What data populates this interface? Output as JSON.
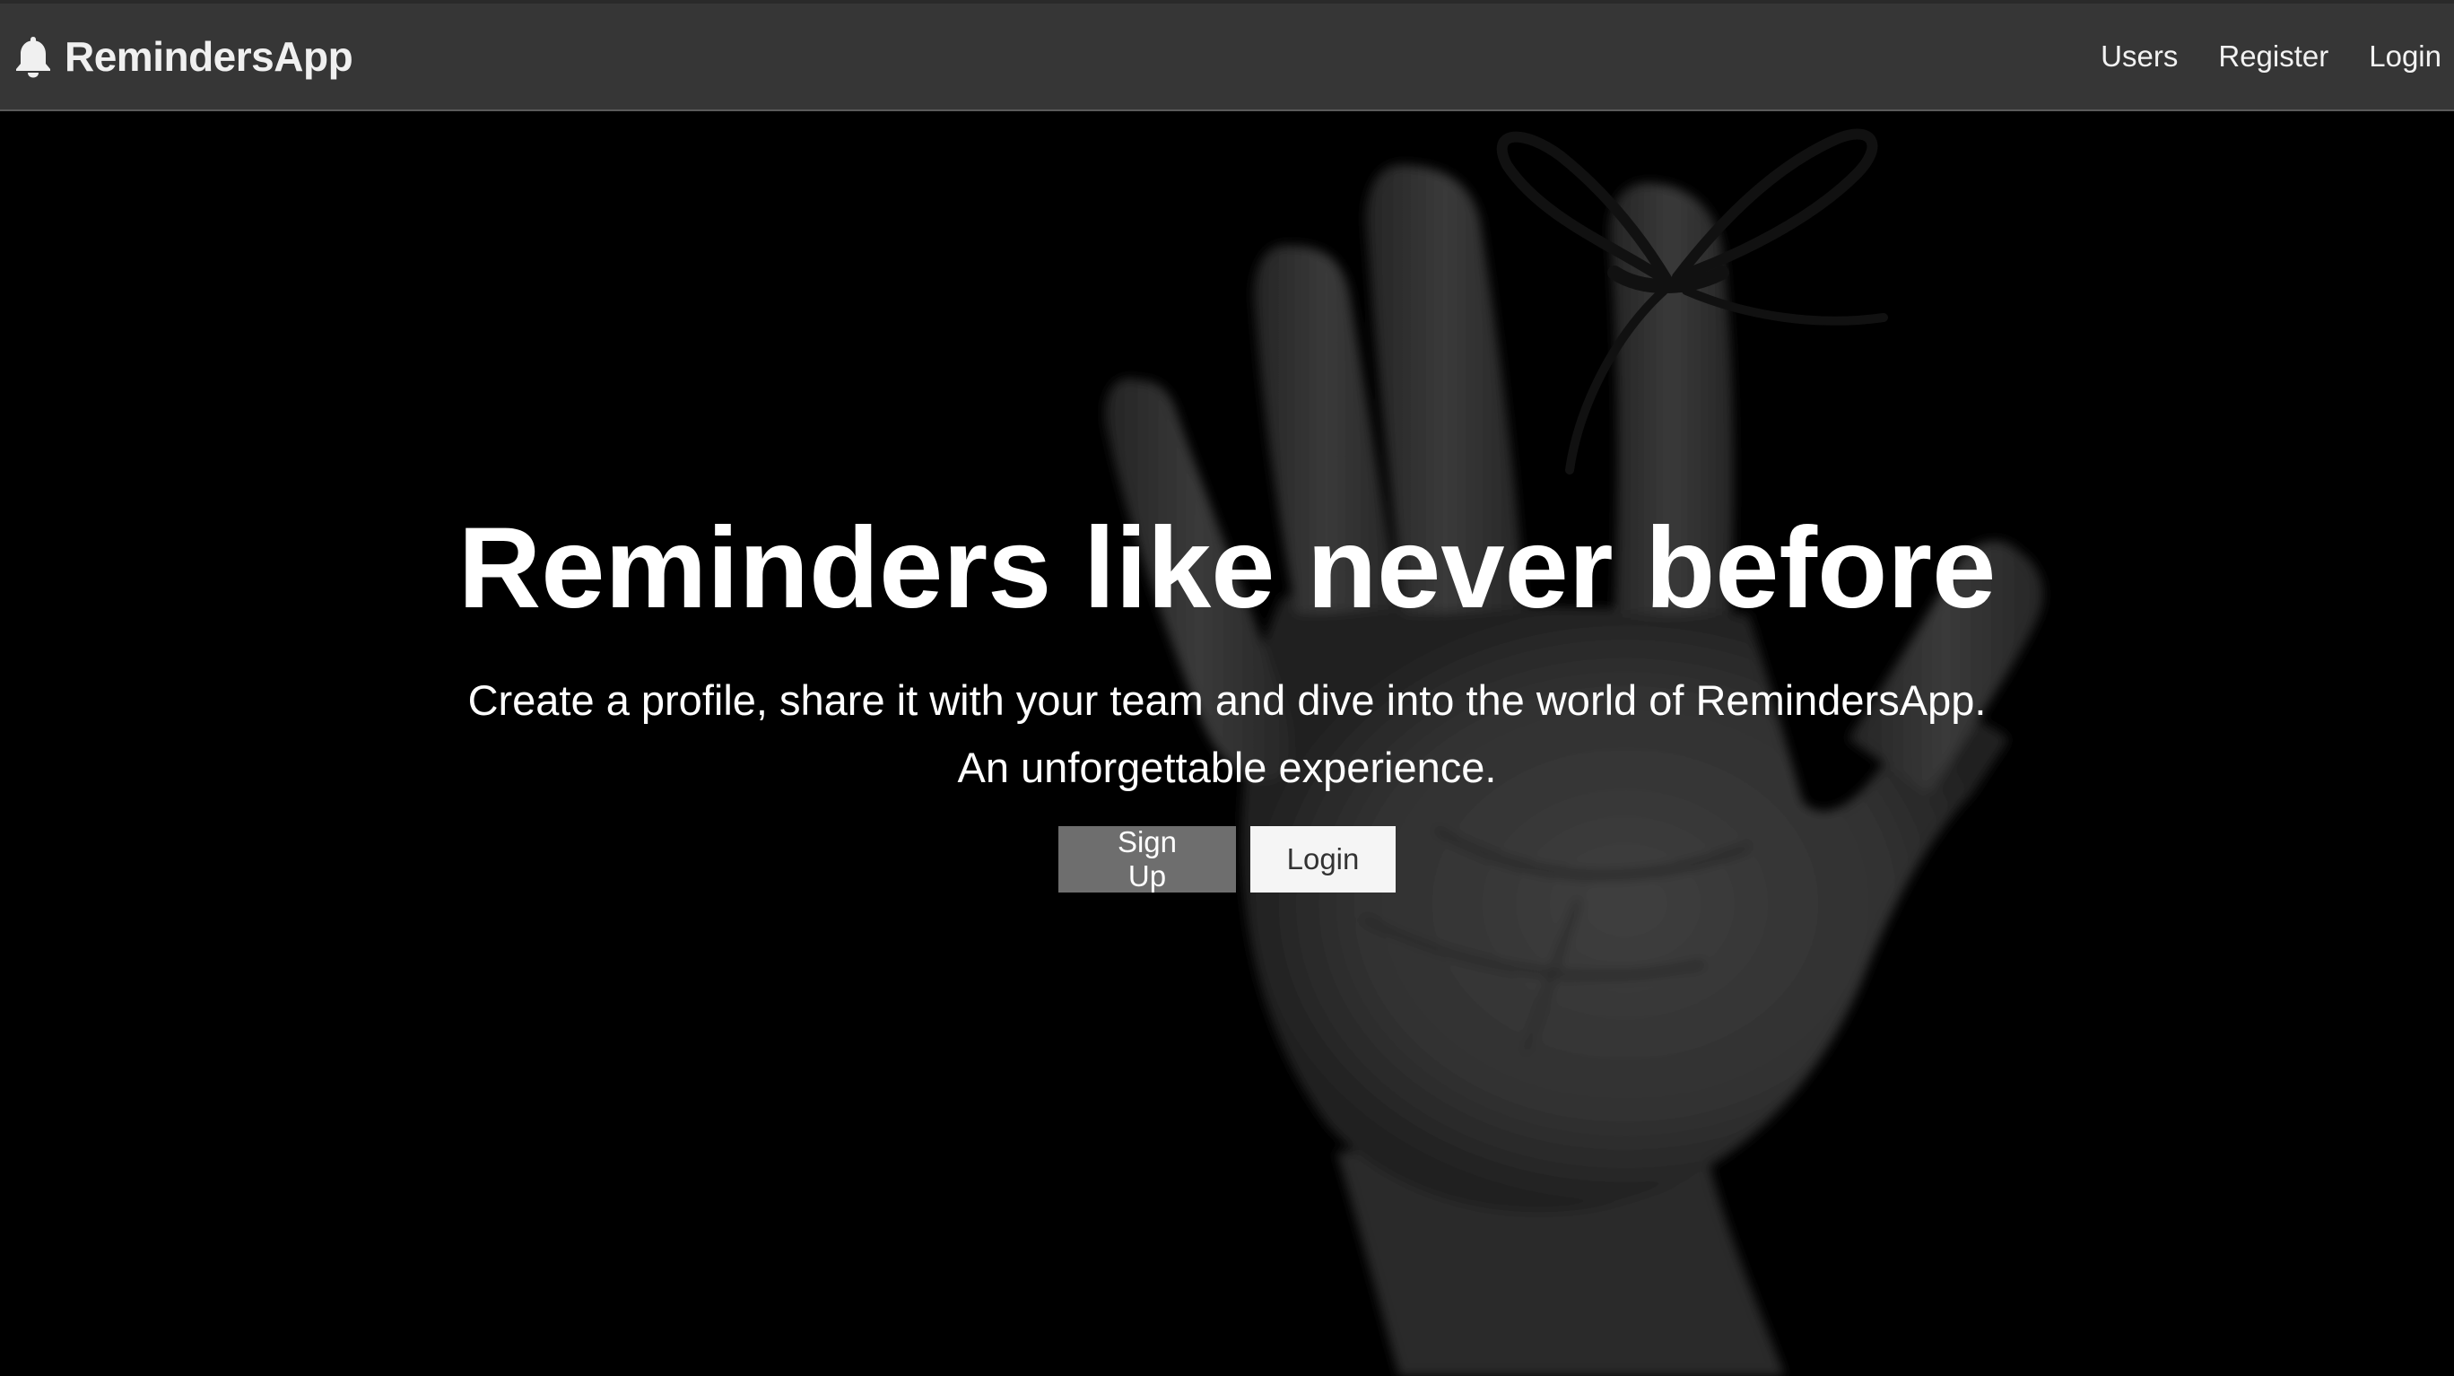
{
  "navbar": {
    "brand": {
      "icon": "bell-icon",
      "name": "RemindersApp"
    },
    "links": [
      {
        "label": "Users"
      },
      {
        "label": "Register"
      },
      {
        "label": "Login"
      }
    ]
  },
  "hero": {
    "background_image": "hand-with-string-tied-on-finger",
    "title": "Reminders like never before",
    "subtitle_lines": [
      "Create a profile, share it with your team and dive into the world of RemindersApp.",
      "An unforgettable experience."
    ],
    "buttons": {
      "signup_label": "Sign Up",
      "login_label": "Login"
    }
  },
  "colors": {
    "navbar_background": "#363636",
    "hero_background": "#000000",
    "signup_button": "#6e6e6e",
    "login_button": "#f5f5f5",
    "text_light": "#ffffff"
  }
}
